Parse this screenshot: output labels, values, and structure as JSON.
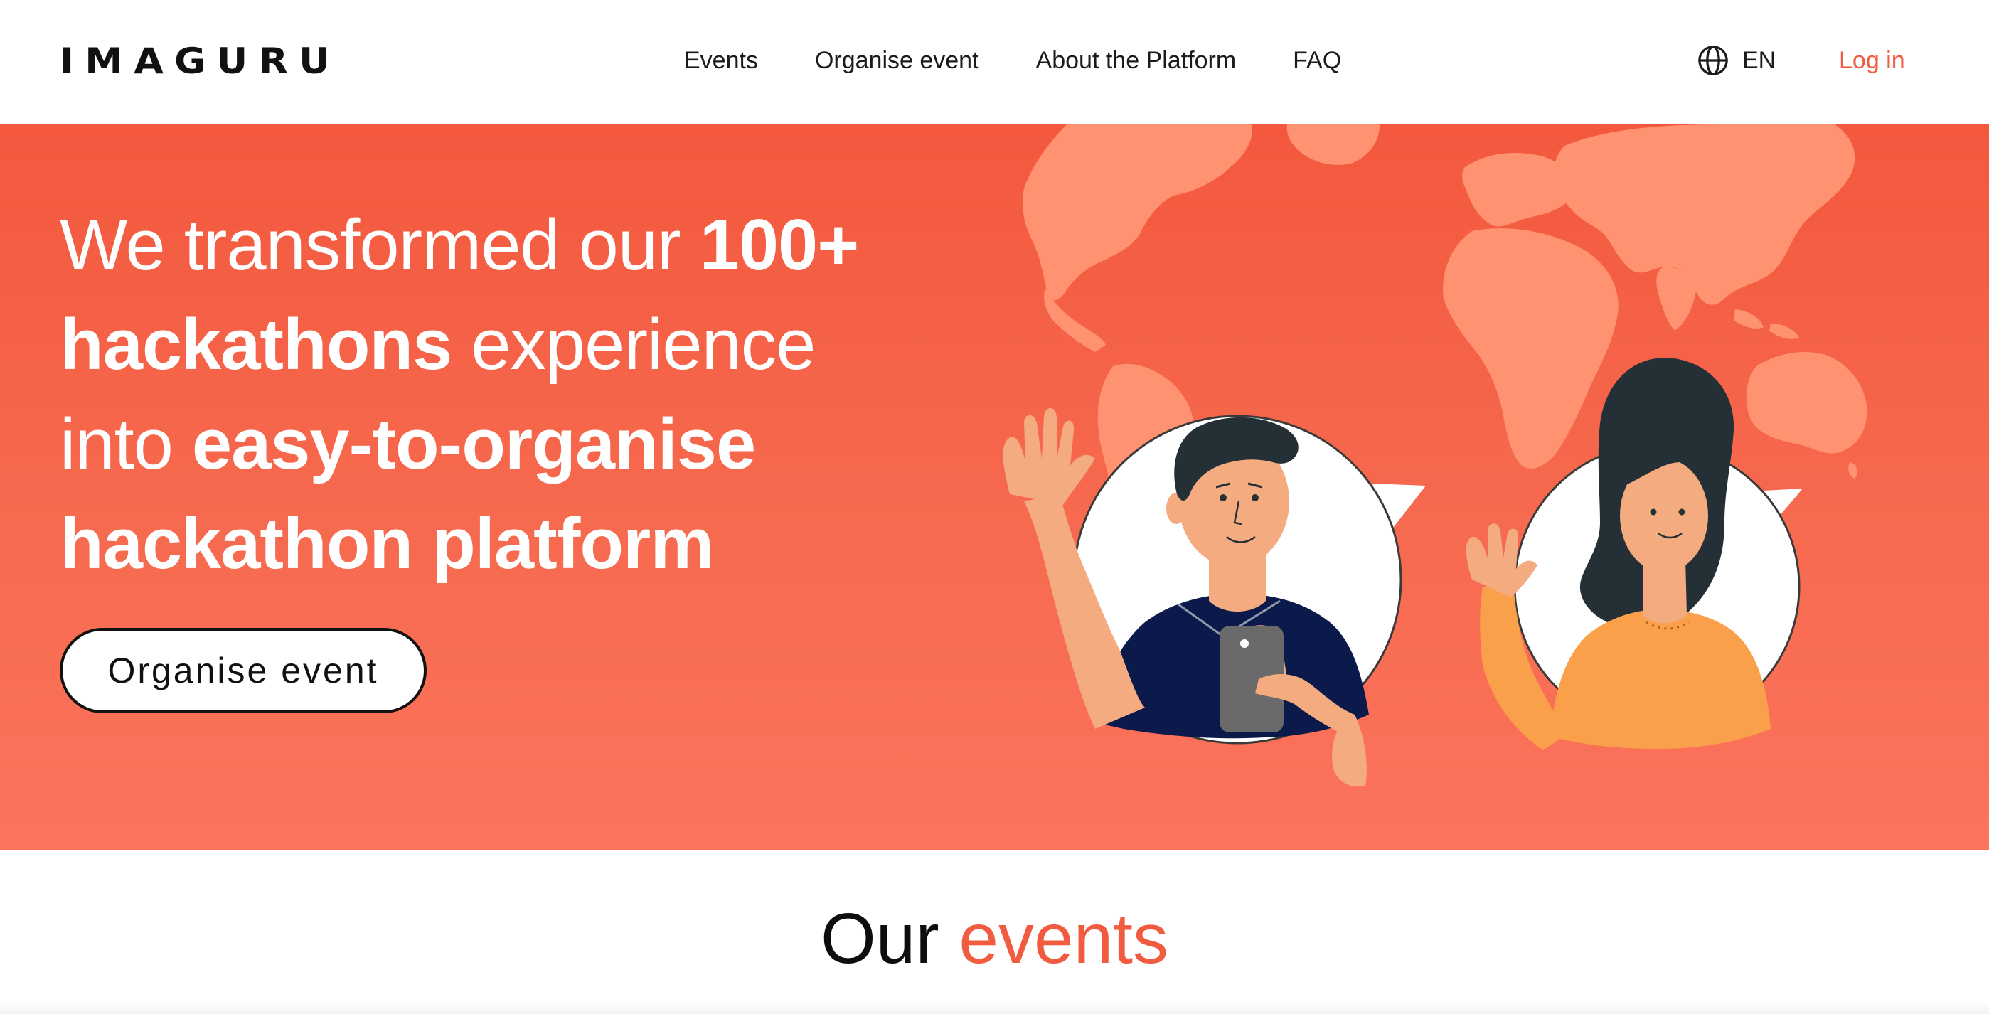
{
  "header": {
    "logo_text": "IMAGURU",
    "nav": [
      "Events",
      "Organise event",
      "About the Platform",
      "FAQ"
    ],
    "language": {
      "icon": "globe-icon",
      "label": "EN"
    },
    "login_label": "Log in"
  },
  "hero": {
    "line1_regular": "We transformed our ",
    "line1_bold": "100+",
    "line2_bold": "hackathons",
    "line2_regular": " experience",
    "line3_regular": "into ",
    "line3_bold": "easy-to-organise",
    "line4_bold": "hackathon platform",
    "cta_label": "Organise event",
    "illustration": "world-map-people-waving-illustration"
  },
  "events_section": {
    "title_part1": "Our ",
    "title_part2": "events"
  },
  "colors": {
    "accent": "#f15b40",
    "hero_top": "#f3583d",
    "hero_bottom": "#fc735c",
    "map": "#ff9270",
    "shirt_navy": "#0b1a4a",
    "sweater_orange": "#fba04a",
    "skin": "#f4ab80",
    "hair": "#253036"
  }
}
